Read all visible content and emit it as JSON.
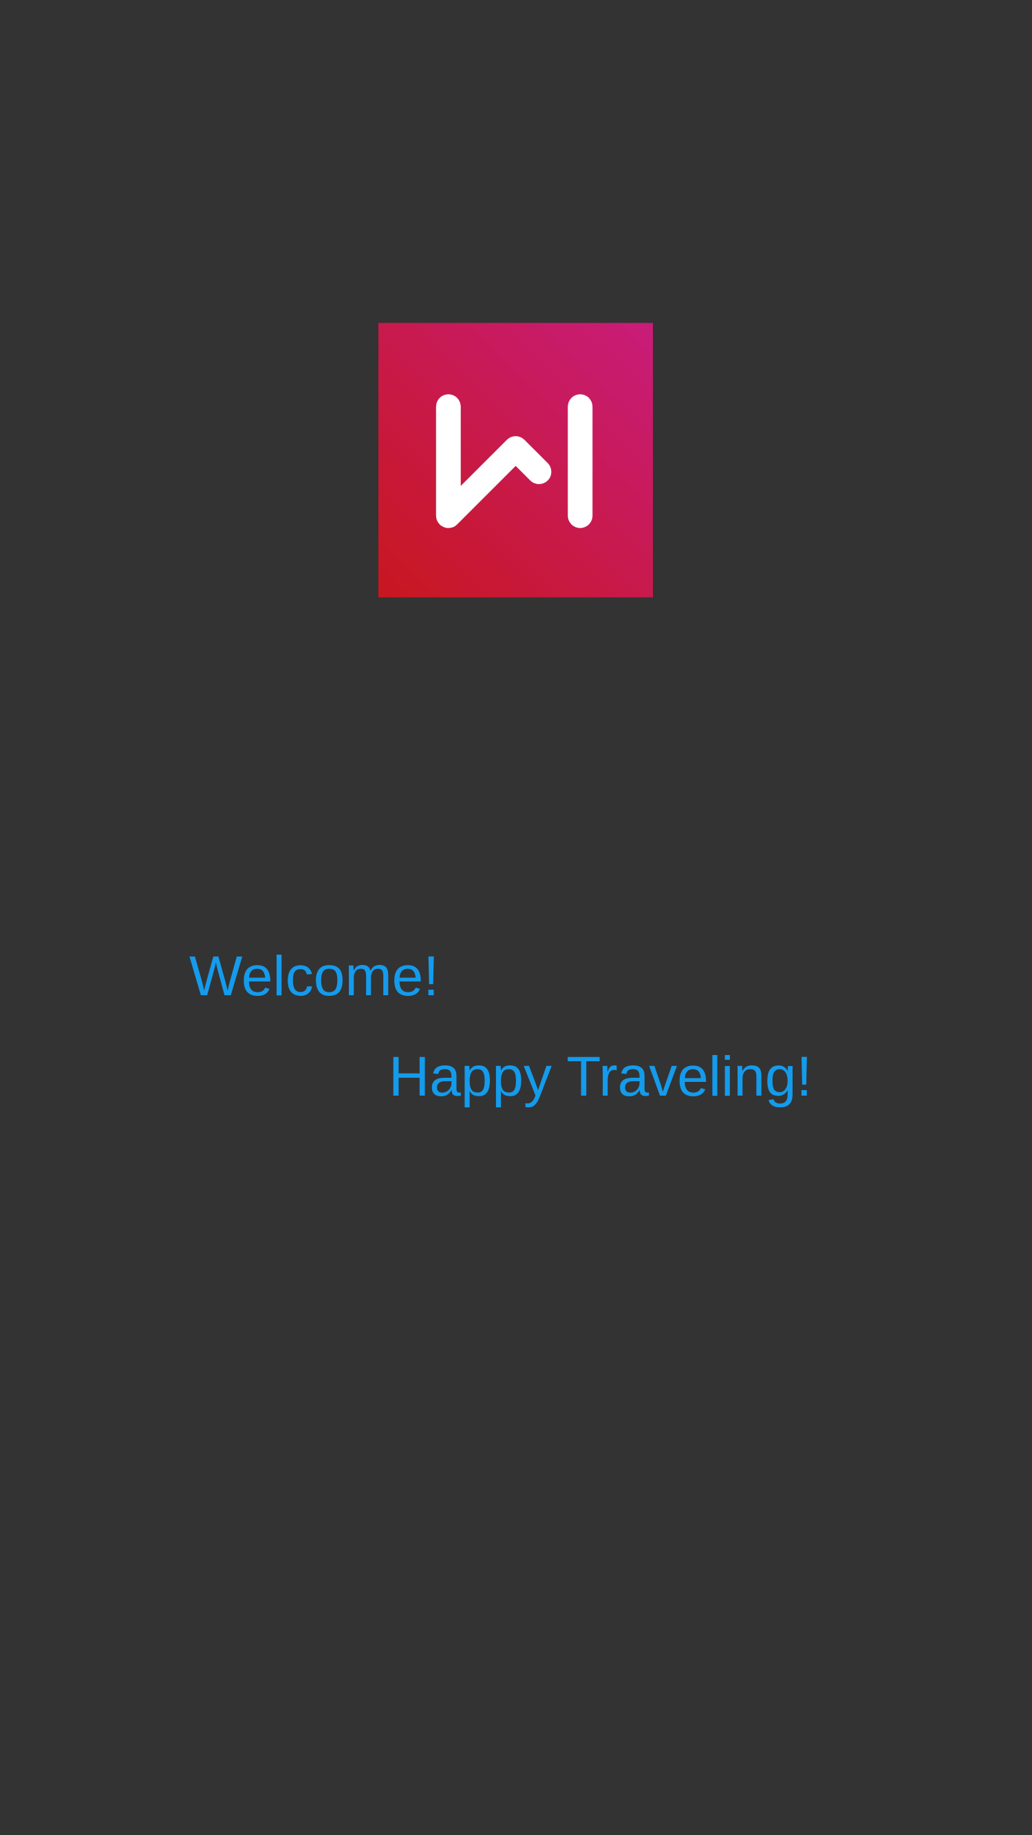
{
  "splash": {
    "logo": {
      "icon": "app-logo-icon",
      "gradient_start": "#C8171F",
      "gradient_end": "#C81C7A",
      "glyph_color": "#FFFFFF"
    },
    "welcome": "Welcome!",
    "tagline": "Happy Traveling!",
    "text_color": "#149BEC",
    "background": "#333333"
  }
}
